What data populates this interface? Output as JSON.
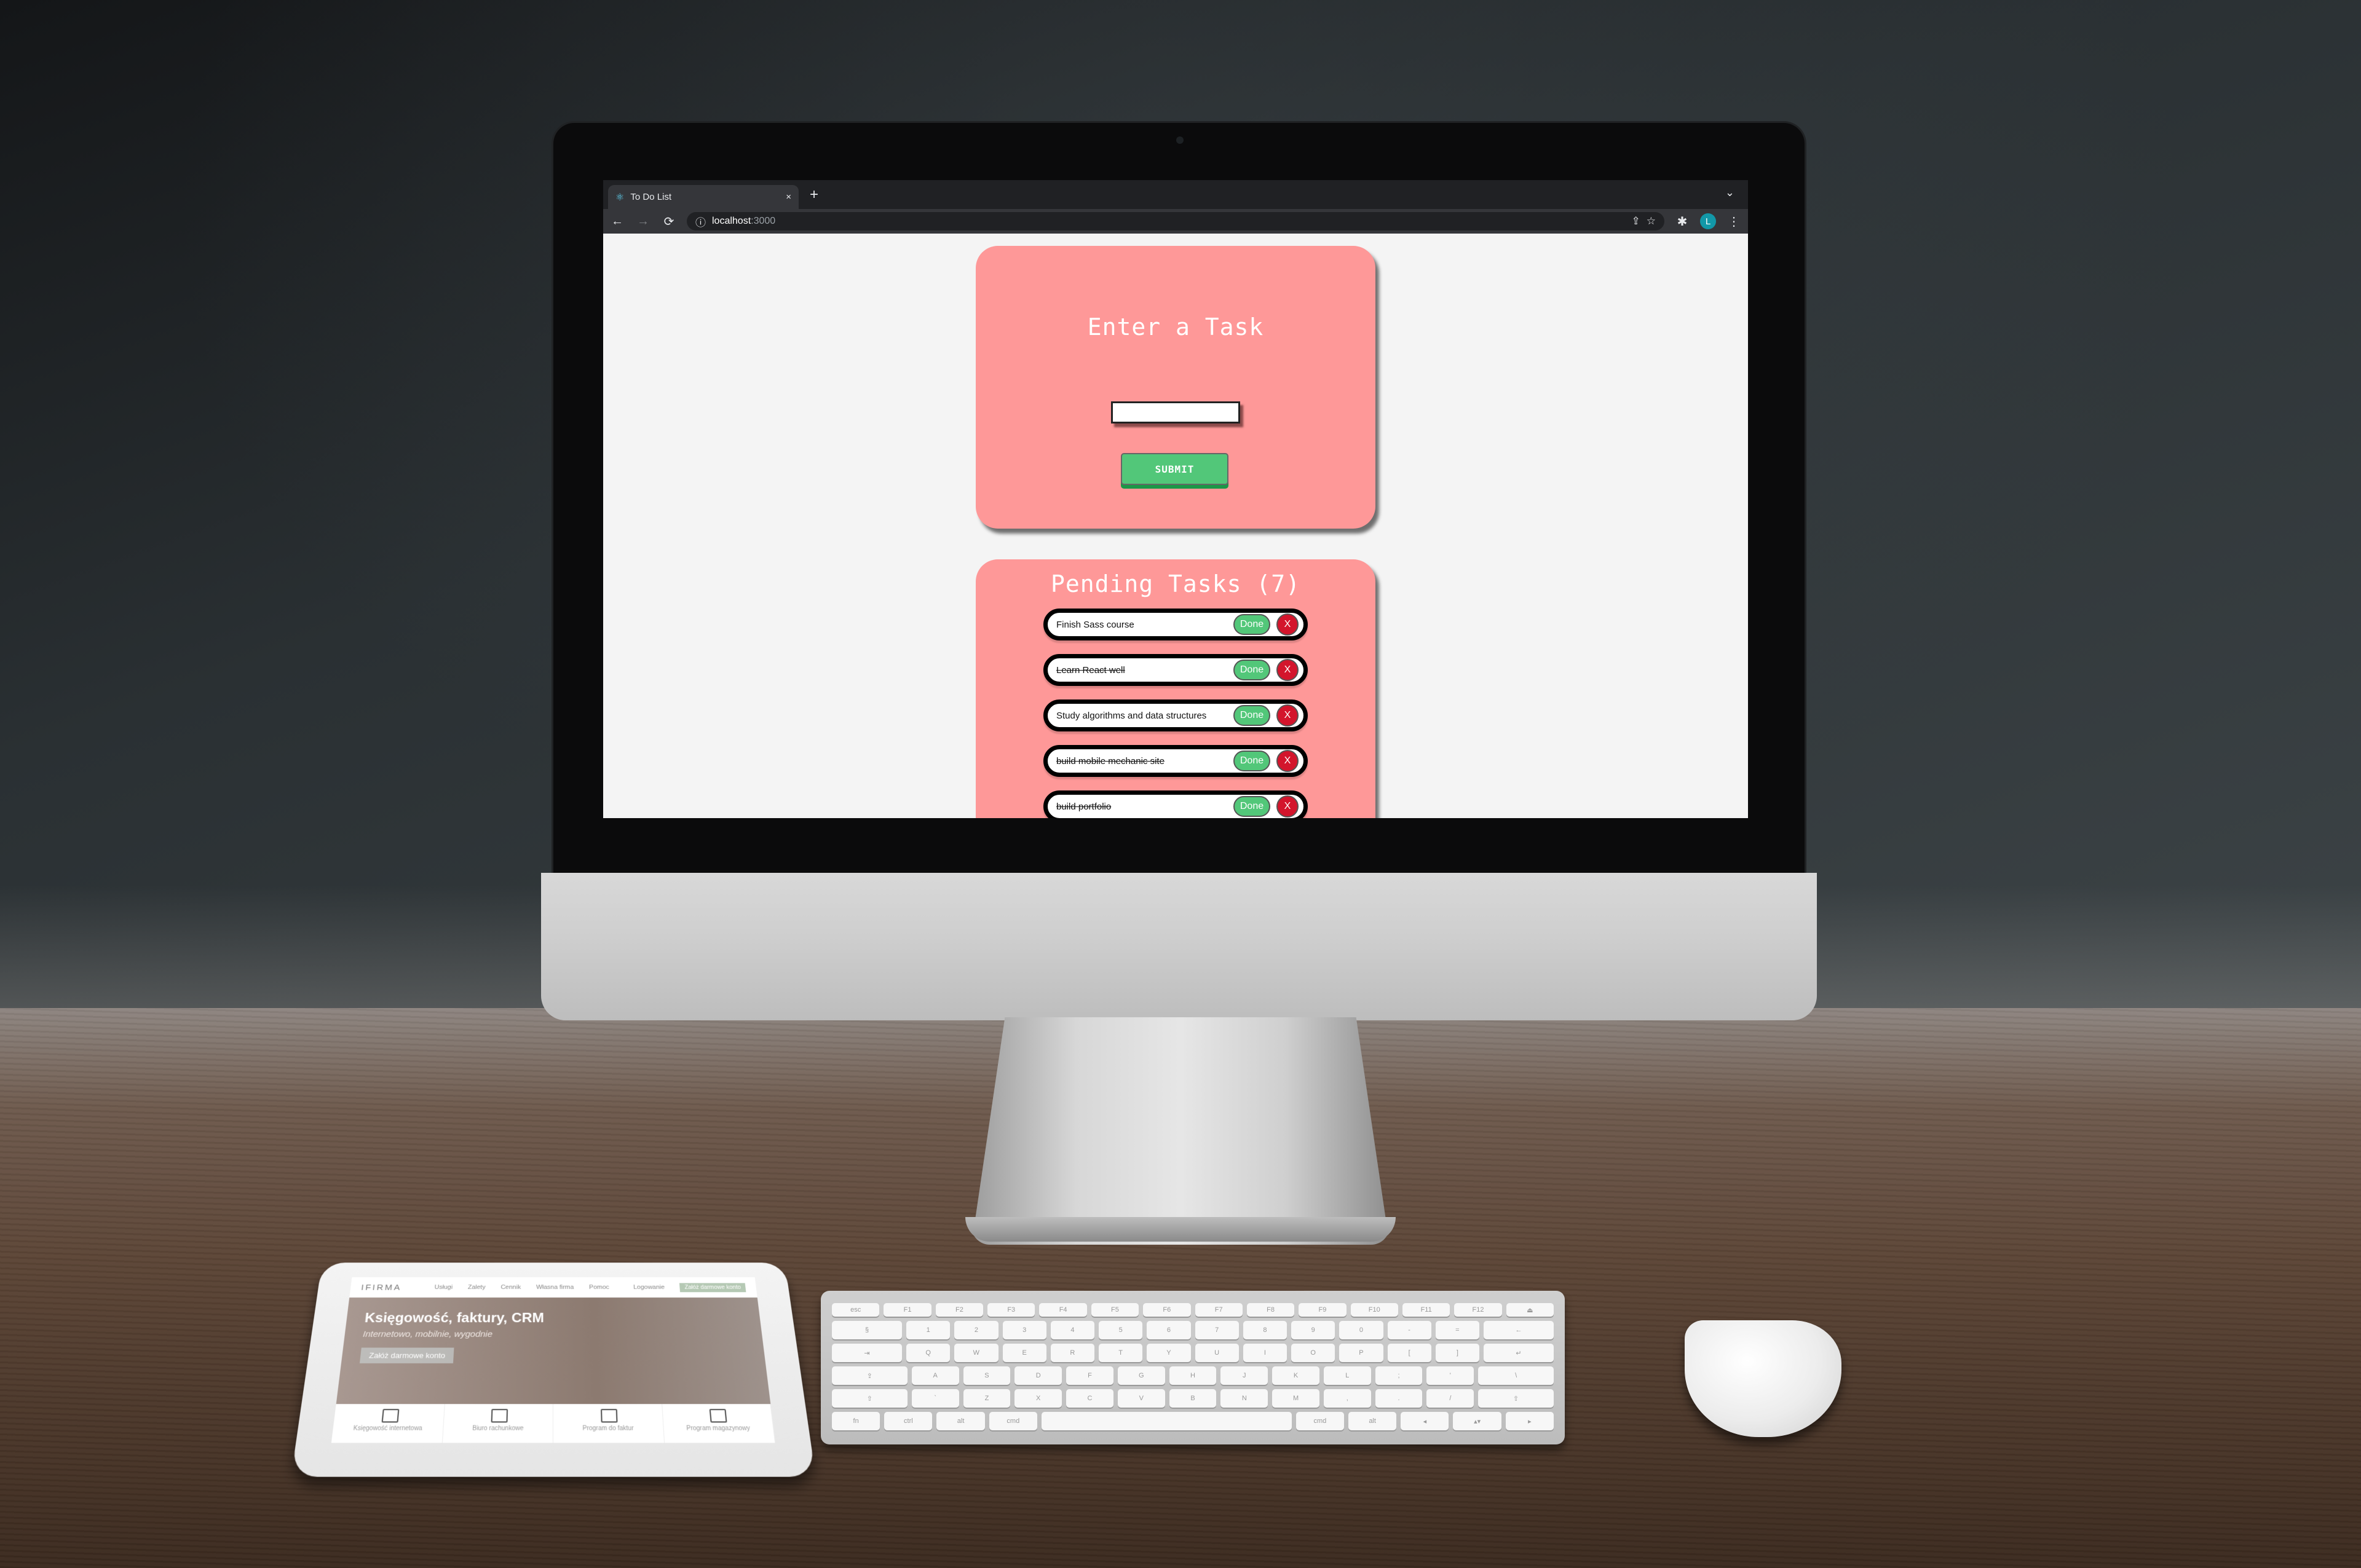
{
  "browser": {
    "tab_title": "To Do List",
    "tab_favicon": "react-atom-icon",
    "new_tab_label": "+",
    "close_tab_label": "×",
    "tab_menu_label": "⌄",
    "url_host": "localhost",
    "url_port": ":3000",
    "profile_initial": "L",
    "nav": {
      "back": "←",
      "forward": "→",
      "reload": "⟳",
      "info": "ⓘ",
      "share": "⇪",
      "bookmark": "☆",
      "extensions": "✱",
      "menu": "⋮"
    },
    "colors": {
      "tabbar": "#202124",
      "toolbar": "#35363a",
      "avatar": "#1298a8"
    }
  },
  "app": {
    "enter_card": {
      "title": "Enter a Task",
      "input_value": "",
      "input_placeholder": "",
      "submit_label": "SUBMIT"
    },
    "pending_card": {
      "title": "Pending Tasks (7)",
      "count": 7,
      "done_label": "Done",
      "delete_label": "X",
      "tasks": [
        {
          "text": "Finish Sass course",
          "completed": false
        },
        {
          "text": "Learn React well",
          "completed": true
        },
        {
          "text": "Study algorithms and data structures",
          "completed": false
        },
        {
          "text": "build mobile mechanic site",
          "completed": true
        },
        {
          "text": "build portfolio",
          "completed": true
        }
      ]
    },
    "colors": {
      "card": "#fe9898",
      "done_button": "#52c779",
      "delete_button": "#d3152c",
      "page_bg": "#f4f4f4"
    }
  },
  "tablet": {
    "logo": "IFIRMA",
    "nav_items": [
      "Usługi",
      "Zalety",
      "Cennik",
      "Własna firma",
      "Pomoc",
      "Logowanie"
    ],
    "cta": "Załóż darmowe konto",
    "hero_title": "Księgowość, faktury, CRM",
    "hero_subtitle": "Internetowo, mobilnie, wygodnie",
    "hero_button": "Załóż darmowe konto",
    "features": [
      "Księgowość internetowa",
      "Biuro rachunkowe",
      "Program do faktur",
      "Program magazynowy"
    ]
  },
  "keyboard": {
    "rows": [
      [
        "esc",
        "F1",
        "F2",
        "F3",
        "F4",
        "F5",
        "F6",
        "F7",
        "F8",
        "F9",
        "F10",
        "F11",
        "F12",
        "⏏"
      ],
      [
        "§",
        "1",
        "2",
        "3",
        "4",
        "5",
        "6",
        "7",
        "8",
        "9",
        "0",
        "-",
        "=",
        "←"
      ],
      [
        "⇥",
        "Q",
        "W",
        "E",
        "R",
        "T",
        "Y",
        "U",
        "I",
        "O",
        "P",
        "[",
        "]",
        "↵"
      ],
      [
        "⇪",
        "A",
        "S",
        "D",
        "F",
        "G",
        "H",
        "J",
        "K",
        "L",
        ";",
        "'",
        "\\"
      ],
      [
        "⇧",
        "`",
        "Z",
        "X",
        "C",
        "V",
        "B",
        "N",
        "M",
        ",",
        ".",
        "/",
        "⇧"
      ],
      [
        "fn",
        "ctrl",
        "alt",
        "cmd",
        "",
        "cmd",
        "alt",
        "◂",
        "▴▾",
        "▸"
      ]
    ]
  }
}
